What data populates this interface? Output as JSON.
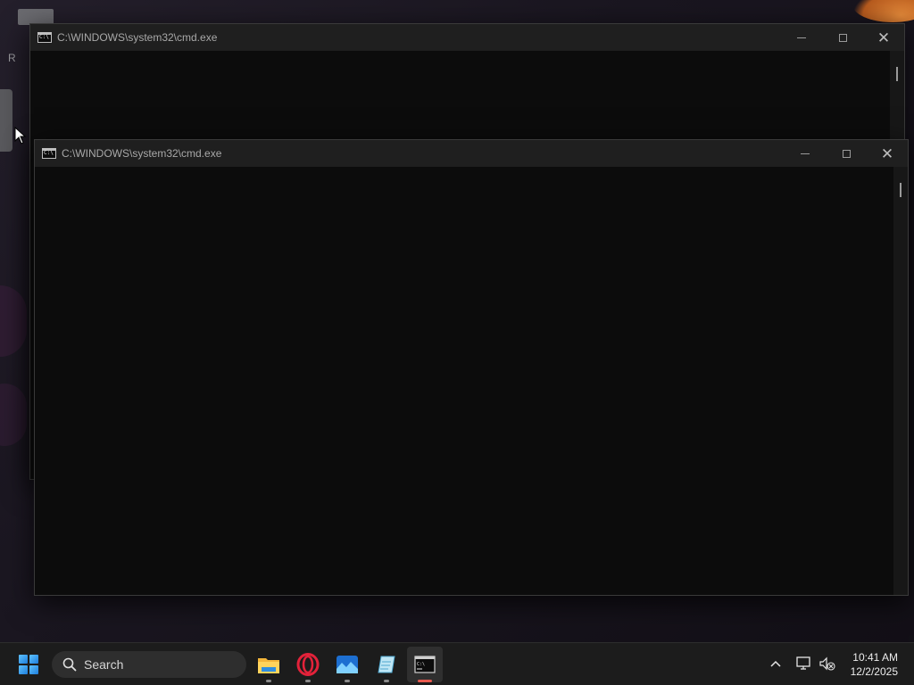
{
  "desktop": {
    "partial_label": "R"
  },
  "windows": [
    {
      "title": "C:\\WINDOWS\\system32\\cmd.exe",
      "state": "background"
    },
    {
      "title": "C:\\WINDOWS\\system32\\cmd.exe",
      "state": "foreground"
    }
  ],
  "taskbar": {
    "search_placeholder": "Search",
    "apps": [
      {
        "icon": "file-explorer-icon"
      },
      {
        "icon": "opera-browser-icon"
      },
      {
        "icon": "photos-icon"
      },
      {
        "icon": "notepad-icon"
      },
      {
        "icon": "terminal-icon",
        "active": true
      }
    ],
    "tray": {
      "time": "10:41 AM",
      "date": "12/2/2025"
    }
  },
  "colors": {
    "console_bg": "#0c0c0c",
    "titlebar_bg": "#1f1f1f",
    "taskbar_bg": "#1c1c1c",
    "active_indicator": "#e85a4f"
  }
}
